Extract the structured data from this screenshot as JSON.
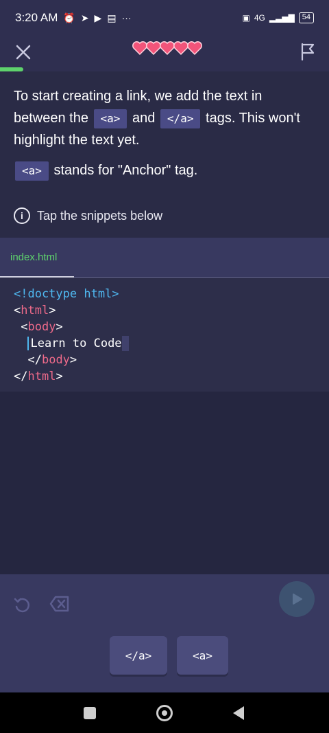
{
  "status_bar": {
    "time": "3:20 AM",
    "icons": [
      "alarm-icon",
      "telegram-icon",
      "play-store-icon",
      "news-icon"
    ],
    "more": "···",
    "network": "4G",
    "battery": "54"
  },
  "top_bar": {
    "close_icon": "close-icon",
    "lives": 5,
    "flag_icon": "flag-icon",
    "progress": 0.07,
    "colors": {
      "heart": "#f2547a",
      "progress": "#5ed26c"
    }
  },
  "lesson": {
    "para1_part1": "To start creating a link, we add the text in between the ",
    "chip_open": "<a>",
    "para1_part2": " and ",
    "chip_close": "</a>",
    "para1_part3": " tags. This won't highlight the text yet.",
    "para2_chip": "<a>",
    "para2_text": " stands for \"Anchor\" tag.",
    "hint": "Tap the snippets below"
  },
  "editor": {
    "file_tab": "index.html",
    "code": {
      "line1": "<!doctype html>",
      "line2_open": "<",
      "line2_tag": "html",
      "line2_close": ">",
      "line3_open": "<",
      "line3_tag": "body",
      "line3_close": ">",
      "line4_text": "Learn to Code",
      "line5_open": "</",
      "line5_tag": "body",
      "line5_close": ">",
      "line6_open": "</",
      "line6_tag": "html",
      "line6_close": ">"
    }
  },
  "controls": {
    "undo_icon": "undo-icon",
    "backspace_icon": "backspace-icon",
    "run_icon": "play-icon",
    "snippets": [
      "</a>",
      "<a>"
    ]
  },
  "nav": {
    "recents_icon": "square-icon",
    "home_icon": "home-icon",
    "back_icon": "back-icon"
  }
}
